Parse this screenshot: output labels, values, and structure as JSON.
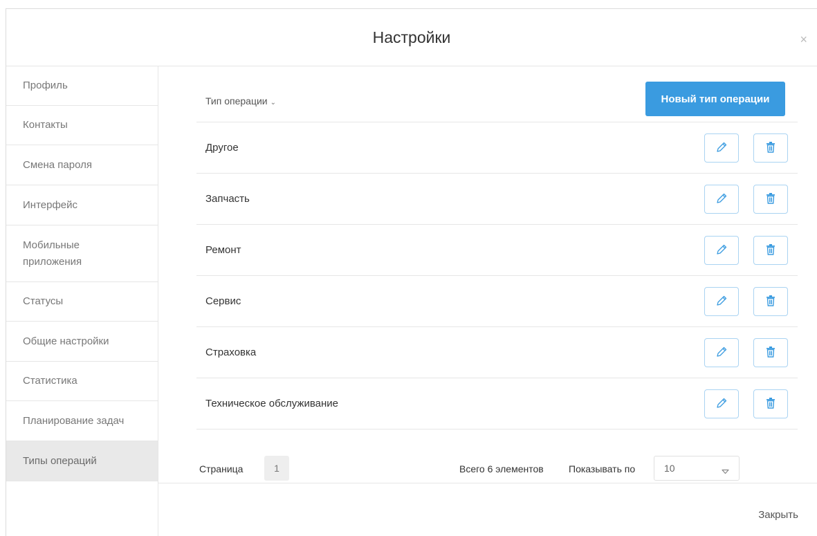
{
  "modal": {
    "title": "Настройки",
    "close_symbol": "×"
  },
  "sidebar": {
    "items": [
      {
        "label": "Профиль"
      },
      {
        "label": "Контакты"
      },
      {
        "label": "Смена пароля"
      },
      {
        "label": "Интерфейс"
      },
      {
        "label": "Мобильные приложения"
      },
      {
        "label": "Статусы"
      },
      {
        "label": "Общие настройки"
      },
      {
        "label": "Статистика"
      },
      {
        "label": "Планирование задач"
      },
      {
        "label": "Типы операций",
        "active": true
      }
    ]
  },
  "table": {
    "column_header": "Тип операции",
    "sort_icon": "chevron-down-icon",
    "new_button_label": "Новый тип операции",
    "rows": [
      {
        "label": "Другое"
      },
      {
        "label": "Запчасть"
      },
      {
        "label": "Ремонт"
      },
      {
        "label": "Сервис"
      },
      {
        "label": "Страховка"
      },
      {
        "label": "Техническое обслуживание"
      }
    ],
    "row_actions": [
      "pencil-icon",
      "trash-icon"
    ]
  },
  "pager": {
    "page_label": "Страница",
    "current_page": "1",
    "total_text": "Всего 6 элементов",
    "per_page_label": "Показывать по",
    "per_page_value": "10"
  },
  "footer": {
    "close_label": "Закрыть"
  },
  "colors": {
    "accent": "#3a9be0",
    "icon_blue": "#3a9be0",
    "icon_button_border": "#a9d3f2",
    "active_sidebar_bg": "#e9e9e9",
    "divider": "#e6e6e6"
  }
}
